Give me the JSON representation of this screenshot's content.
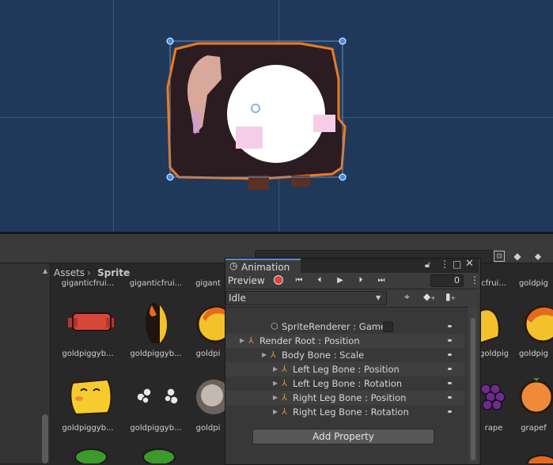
{
  "project": {
    "breadcrumb": [
      "Assets",
      "Sprite"
    ],
    "assets_row0": [
      "giganticfrui...",
      "giganticfrui...",
      "gigant"
    ],
    "assets_row0_right": [
      "cfrui...",
      "goldpig"
    ],
    "assets_row1": [
      "goldpiggyb...",
      "goldpiggyb...",
      "goldpi"
    ],
    "assets_row1_right": [
      "goldpiggyb...",
      "goldpig"
    ],
    "assets_row2": [
      "goldpiggyb...",
      "goldpiggyb...",
      "goldpi"
    ],
    "assets_row2_right": [
      "rape",
      "grapef"
    ]
  },
  "animation": {
    "tab_title": "Animation",
    "preview_label": "Preview",
    "frame": "0",
    "clip": "Idle",
    "properties": [
      {
        "label": "SpriteRenderer : Game",
        "indent": 0,
        "icon": "cube-icon"
      },
      {
        "label": "Render Root : Position",
        "indent": 0,
        "icon": "transform-icon"
      },
      {
        "label": "Body Bone : Scale",
        "indent": 1,
        "icon": "transform-icon"
      },
      {
        "label": "Left Leg Bone : Position",
        "indent": 2,
        "icon": "transform-icon"
      },
      {
        "label": "Left Leg Bone : Rotation",
        "indent": 2,
        "icon": "transform-icon"
      },
      {
        "label": "Right Leg Bone : Position",
        "indent": 2,
        "icon": "transform-icon"
      },
      {
        "label": "Right Leg Bone : Rotation",
        "indent": 2,
        "icon": "transform-icon"
      }
    ],
    "add_property": "Add Property"
  },
  "colors": {
    "scene_bg": "#20395a",
    "selection_outline": "#f07a1e",
    "handle_blue": "#3d8ef0"
  }
}
